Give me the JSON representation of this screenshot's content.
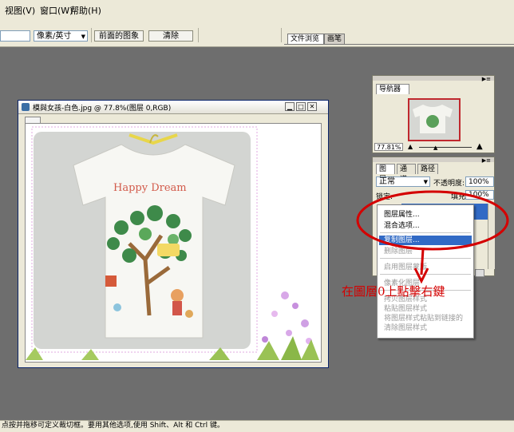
{
  "menubar": {
    "items": [
      "视图(V)",
      "窗口(W)",
      "帮助(H)"
    ]
  },
  "options": {
    "unit_select": "像素/英寸",
    "front_image_button": "前面的图象",
    "clear_button": "清除",
    "tabs": [
      "文件浏览",
      "画笔"
    ]
  },
  "document": {
    "title": "模與女孩-白色.jpg @ 77.8%(图层 0,RGB)"
  },
  "navigator": {
    "tab": "导航器",
    "zoom": "77.81%"
  },
  "layers": {
    "tabs": [
      "图层",
      "通道",
      "路径"
    ],
    "blend_mode": "正常",
    "opacity_label": "不透明度:",
    "opacity_value": "100%",
    "lock_label": "锁定:",
    "fill_label": "填充:",
    "fill_value": "100%"
  },
  "context_menu": {
    "items": [
      {
        "label": "图层属性...",
        "disabled": false
      },
      {
        "label": "混合选项...",
        "disabled": false
      },
      {
        "label": "复制图层...",
        "disabled": false,
        "highlighted": true
      },
      {
        "label": "删除图层",
        "disabled": true
      },
      {
        "label": "启用图层蒙版",
        "disabled": true
      },
      {
        "label": "像素化图层",
        "disabled": true
      },
      {
        "label": "拷贝图层样式",
        "disabled": true
      },
      {
        "label": "粘贴图层样式",
        "disabled": true
      },
      {
        "label": "将图层样式粘贴到链接的",
        "disabled": true
      },
      {
        "label": "清除图层样式",
        "disabled": true
      }
    ]
  },
  "annotation": {
    "text": "在圖層0上點擊右鍵",
    "color": "#d40000"
  },
  "artwork": {
    "tshirt_text": "Happy Dream"
  },
  "status": {
    "text": "点按并拖移可定义裁切框。要用其他选项,使用 Shift、Alt 和 Ctrl 键。"
  },
  "colors": {
    "highlight": "#316ac5",
    "annotation": "#d40000",
    "workspace": "#6e6e6e"
  }
}
